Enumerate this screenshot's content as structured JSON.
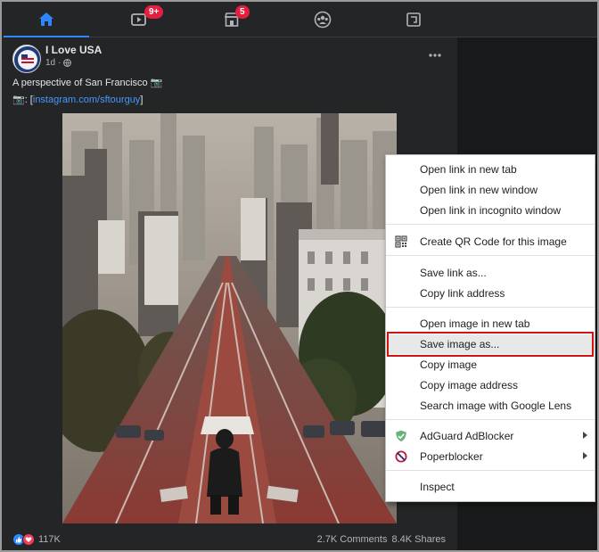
{
  "nav": {
    "tabs": [
      {
        "icon": "home-icon",
        "active": true
      },
      {
        "icon": "watch-icon",
        "badge": "9+"
      },
      {
        "icon": "marketplace-icon",
        "badge": "5"
      },
      {
        "icon": "groups-icon"
      },
      {
        "icon": "gaming-icon"
      }
    ]
  },
  "post": {
    "page_name": "I Love USA",
    "time": "1d",
    "caption": "A perspective of San Francisco 📷",
    "link_prefix": "📷: [",
    "link_text": "instagram.com/sftourguy",
    "link_suffix": "]",
    "reaction_count": "117K",
    "comments": "2.7K Comments",
    "shares": "8.4K Shares"
  },
  "context_menu": {
    "groups": [
      {
        "items": [
          {
            "label": "Open link in new tab"
          },
          {
            "label": "Open link in new window"
          },
          {
            "label": "Open link in incognito window"
          }
        ]
      },
      {
        "items": [
          {
            "label": "Create QR Code for this image",
            "icon": "qr-code-icon"
          }
        ]
      },
      {
        "items": [
          {
            "label": "Save link as..."
          },
          {
            "label": "Copy link address"
          }
        ]
      },
      {
        "items": [
          {
            "label": "Open image in new tab"
          },
          {
            "label": "Save image as...",
            "highlighted": true
          },
          {
            "label": "Copy image"
          },
          {
            "label": "Copy image address"
          },
          {
            "label": "Search image with Google Lens"
          }
        ]
      },
      {
        "items": [
          {
            "label": "AdGuard AdBlocker",
            "icon": "adguard-shield-icon",
            "submenu": true
          },
          {
            "label": "Poperblocker",
            "icon": "poperblocker-icon",
            "submenu": true
          }
        ]
      },
      {
        "items": [
          {
            "label": "Inspect"
          }
        ]
      }
    ]
  },
  "colors": {
    "accent": "#2d88ff",
    "badge": "#e41e3f",
    "link": "#4599ff",
    "highlight_border": "#d01414"
  }
}
